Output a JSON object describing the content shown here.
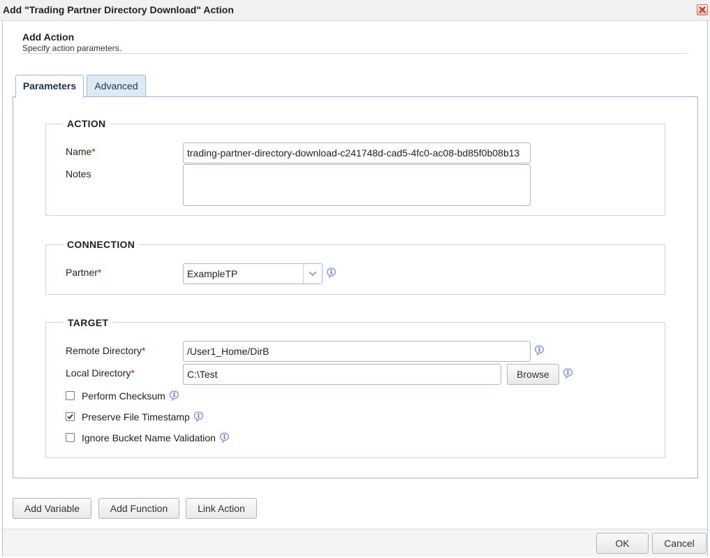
{
  "window": {
    "title": "Add \"Trading Partner Directory Download\" Action"
  },
  "header": {
    "title": "Add Action",
    "subtitle": "Specify action parameters."
  },
  "tabs": [
    {
      "label": "Parameters",
      "active": true
    },
    {
      "label": "Advanced",
      "active": false
    }
  ],
  "action_section": {
    "legend": "ACTION",
    "name_label": "Name",
    "name_value": "trading-partner-directory-download-c241748d-cad5-4fc0-ac08-bd85f0b08b13",
    "notes_label": "Notes",
    "notes_value": ""
  },
  "connection_section": {
    "legend": "CONNECTION",
    "partner_label": "Partner",
    "partner_value": "ExampleTP"
  },
  "target_section": {
    "legend": "TARGET",
    "remote_dir_label": "Remote Directory",
    "remote_dir_value": "/User1_Home/DirB",
    "local_dir_label": "Local Directory",
    "local_dir_value": "C:\\Test",
    "browse_label": "Browse",
    "checkboxes": [
      {
        "label": "Perform Checksum",
        "checked": false
      },
      {
        "label": "Preserve File Timestamp",
        "checked": true
      },
      {
        "label": "Ignore Bucket Name Validation",
        "checked": false
      }
    ]
  },
  "bottom_buttons": {
    "add_variable": "Add Variable",
    "add_function": "Add Function",
    "link_action": "Link Action"
  },
  "footer": {
    "ok": "OK",
    "cancel": "Cancel"
  },
  "required_marker": "*",
  "icons": {
    "close": "close-icon",
    "info": "info-icon",
    "dropdown": "chevron-down-icon",
    "check": "checkmark-icon"
  },
  "colors": {
    "required": "#cc1111",
    "tab_border": "#9bb8d6",
    "info_icon": "#6a7fc8"
  }
}
